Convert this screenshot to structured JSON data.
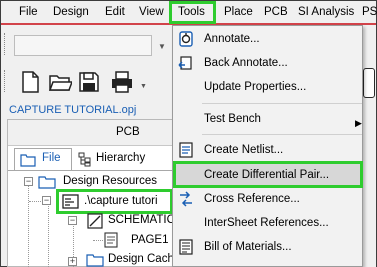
{
  "menubar": {
    "items": [
      "File",
      "Design",
      "Edit",
      "View",
      "Tools",
      "Place",
      "PCB",
      "SI Analysis",
      "PS"
    ],
    "active": "Tools"
  },
  "project": {
    "title": "CAPTURE TUTORIAL.opj",
    "panel_header": "PCB",
    "tabs": [
      "File",
      "Hierarchy"
    ]
  },
  "tree": {
    "items": [
      {
        "label": "Design Resources"
      },
      {
        "label": ".\\capture tutori"
      },
      {
        "label": "SCHEMATIC"
      },
      {
        "label": "PAGE1"
      },
      {
        "label": "Design Cach"
      }
    ]
  },
  "tools_menu": {
    "items": [
      {
        "label": "Annotate...",
        "icon": "annotate-icon"
      },
      {
        "label": "Back Annotate...",
        "icon": "back-annotate-icon"
      },
      {
        "label": "Update Properties...",
        "icon": ""
      },
      {
        "label": "Test Bench",
        "icon": "",
        "submenu": true
      },
      {
        "label": "Create Netlist...",
        "icon": "netlist-icon"
      },
      {
        "label": "Create Differential Pair...",
        "icon": "",
        "highlighted": true
      },
      {
        "label": "Cross Reference...",
        "icon": "cross-reference-icon"
      },
      {
        "label": "InterSheet References...",
        "icon": ""
      },
      {
        "label": "Bill of Materials...",
        "icon": "bom-icon"
      }
    ]
  },
  "colors": {
    "menubar_underline": "#d2434a",
    "callout_outline": "#2ecc2e",
    "highlight_bg": "#d7d7d7",
    "link_blue": "#1a5fb4"
  }
}
